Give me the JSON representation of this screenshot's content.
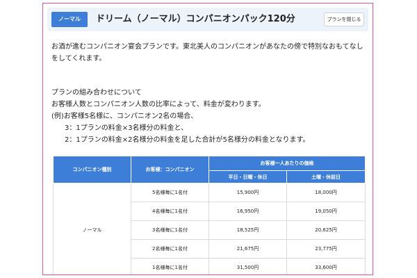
{
  "header": {
    "badge": "ノーマル",
    "title": "ドリーム（ノーマル）コンパニオンパック120分",
    "close_label": "プランを閉じる"
  },
  "description": [
    "お酒が進むコンパニオン宴会プランです。東北美人のコンパニオンがあなたの傍で特別なおもてなし",
    "をしてくれます。"
  ],
  "combination": {
    "heading": "プランの組み合わせについて",
    "line1": "お客様人数とコンパニオン人数の比率によって、料金が変わります。",
    "line2": "(例)お客様5名様に、コンパニオン2名の場合、",
    "line3": "3：1プランの料金×3名様分の料金と、",
    "line4": "2：1プランの料金×2名様分の料金を足した合計が5名様分の料金となります。"
  },
  "table": {
    "headers": {
      "companion_type": "コンパニオン種別",
      "ratio": "お客様：コンパニオン",
      "price_group": "お客様一人あたりの価格",
      "weekday": "平日・日曜・休日",
      "holiday_eve": "土曜・休前日"
    },
    "type_name": "ノーマル",
    "rows": [
      {
        "ratio": "5名様毎に1名付",
        "weekday": "15,900円",
        "holiday_eve": "18,000円"
      },
      {
        "ratio": "4名様毎に1名付",
        "weekday": "16,950円",
        "holiday_eve": "19,050円"
      },
      {
        "ratio": "3名様毎に1名付",
        "weekday": "18,525円",
        "holiday_eve": "20,625円"
      },
      {
        "ratio": "2名様毎に1名付",
        "weekday": "21,675円",
        "holiday_eve": "23,775円"
      },
      {
        "ratio": "1名様毎に1名付",
        "weekday": "31,500円",
        "holiday_eve": "33,600円"
      }
    ]
  },
  "colors": {
    "accent": "#3d7ed8",
    "frame_border": "#e04fa6",
    "header_bg": "#edf3fb"
  }
}
